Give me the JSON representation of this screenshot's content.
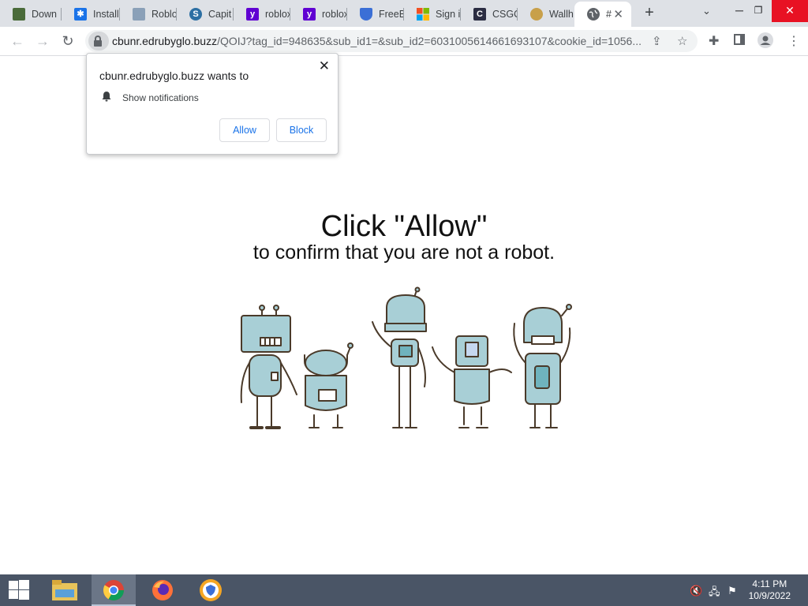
{
  "tabs": [
    {
      "title": "Down",
      "icon": "wolf-game-icon",
      "color": "#4a6b3a"
    },
    {
      "title": "Install",
      "icon": "snowflake-icon",
      "color": "#1a73e8"
    },
    {
      "title": "Roblo",
      "icon": "pencil-page-icon",
      "color": "#8aa0b8"
    },
    {
      "title": "Capit",
      "icon": "s-circle-icon",
      "color": "#2c6fa3"
    },
    {
      "title": "roblox",
      "icon": "yahoo-icon",
      "color": "#6001d2"
    },
    {
      "title": "roblox",
      "icon": "yahoo-icon",
      "color": "#6001d2"
    },
    {
      "title": "FreeB",
      "icon": "shield-icon",
      "color": "#3b6fd6"
    },
    {
      "title": "Sign i",
      "icon": "microsoft-icon",
      "color": "#f25022"
    },
    {
      "title": "CSGO",
      "icon": "csgo-icon",
      "color": "#2b2d42"
    },
    {
      "title": "Wallh",
      "icon": "doge-icon",
      "color": "#c8a04a"
    },
    {
      "title": "#",
      "icon": "globe-icon",
      "color": "#5f6368"
    }
  ],
  "omnibox": {
    "host": "cbunr.edrubyglo.buzz",
    "path": "/QOIJ?tag_id=948635&sub_id1=&sub_id2=6031005614661693107&cookie_id=1056..."
  },
  "popup": {
    "title": "cbunr.edrubyglo.buzz wants to",
    "permission": "Show notifications",
    "allow_label": "Allow",
    "block_label": "Block"
  },
  "page": {
    "headline": "Click \"Allow\"",
    "subline": "to confirm that you are not a robot."
  },
  "taskbar": {
    "time": "4:11 PM",
    "date": "10/9/2022",
    "apps": [
      "file-explorer-icon",
      "chrome-icon",
      "firefox-icon",
      "browser-shield-icon"
    ]
  },
  "colors": {
    "accent_blue": "#1a73e8",
    "robot_body": "#a8cfd6",
    "robot_outline": "#4a3a2a",
    "taskbar": "#4a5566",
    "close_red": "#e81123"
  }
}
